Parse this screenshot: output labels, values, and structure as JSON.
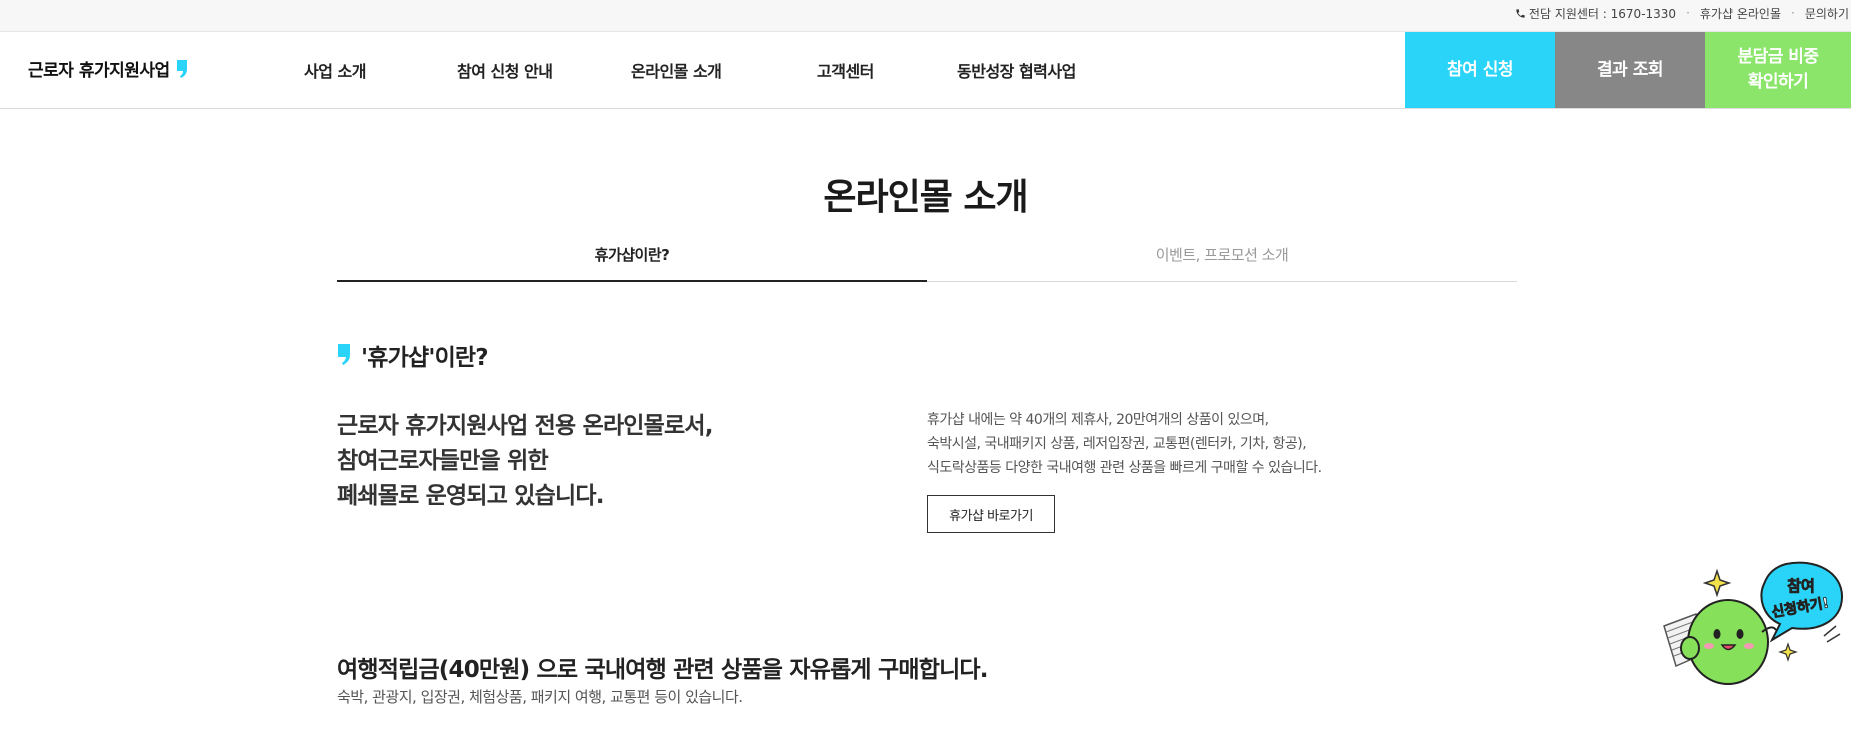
{
  "topbar": {
    "phone_label": "전담 지원센터 : 1670-1330",
    "separator": "·",
    "mall_link": "휴가샵 온라인몰",
    "inquiry_link": "문의하기"
  },
  "header": {
    "logo_text": "근로자 휴가지원사업",
    "nav": [
      "사업 소개",
      "참여 신청 안내",
      "온라인몰 소개",
      "고객센터",
      "동반성장 협력사업"
    ],
    "cta_apply": "참여 신청",
    "cta_result": "결과 조회",
    "cta_check_line1": "분담금 비중",
    "cta_check_line2": "확인하기"
  },
  "main": {
    "page_title": "온라인몰 소개",
    "tabs": [
      {
        "label": "휴가샵이란?",
        "active": true
      },
      {
        "label": "이벤트, 프로모션 소개",
        "active": false
      }
    ],
    "section_title": "'휴가샵'이란?",
    "lead": [
      "근로자 휴가지원사업 전용 온라인몰로서,",
      "참여근로자들만을 위한",
      "폐쇄몰로 운영되고 있습니다."
    ],
    "description": [
      "휴가샵 내에는 약 40개의 제휴사, 20만여개의 상품이 있으며,",
      "숙박시설, 국내패키지 상품, 레저입장권, 교통편(렌터카, 기차, 항공),",
      "식도락상품등 다양한 국내여행 관련 상품을 빠르게 구매할 수 있습니다."
    ],
    "shop_button": "휴가샵 바로가기",
    "points_title": "여행적립금(40만원) 으로 국내여행 관련 상품을 자유롭게 구매합니다.",
    "points_desc": "숙박, 관광지, 입장권, 체험상품, 패키지 여행, 교통편 등이 있습니다."
  },
  "floating": {
    "bubble_line1": "참여",
    "bubble_line2": "신청하기!"
  },
  "colors": {
    "accent_cyan": "#29d4f8",
    "gray_button": "#878787",
    "green_button": "#8be56b",
    "mascot_green": "#86e05a"
  }
}
